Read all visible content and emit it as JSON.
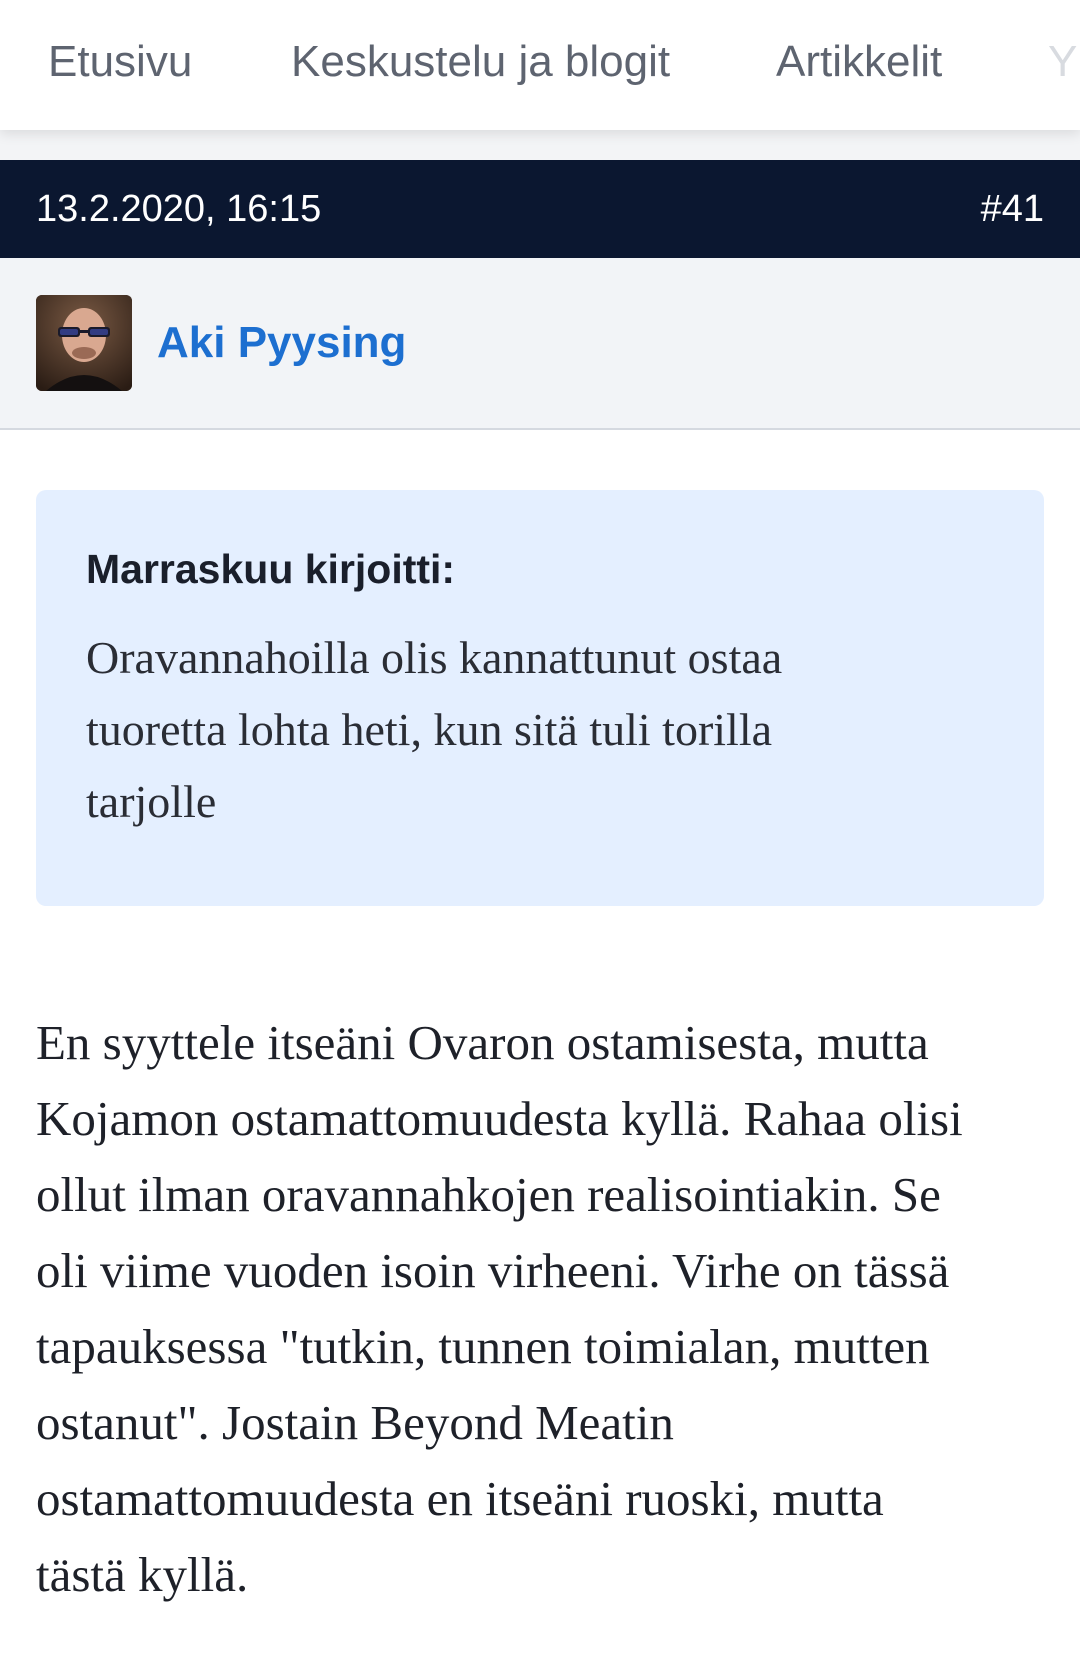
{
  "nav": {
    "tabs": [
      {
        "label": "Etusivu"
      },
      {
        "label": "Keskustelu ja blogit"
      },
      {
        "label": "Artikkelit"
      },
      {
        "label": "Y"
      }
    ]
  },
  "post": {
    "date": "13.2.2020, 16:15",
    "number": "#41",
    "author": "Aki Pyysing",
    "quote": {
      "author": "Marraskuu kirjoitti:",
      "lines": [
        "Oravannahoilla olis kannattunut ostaa",
        "tuoretta lohta heti, kun sitä tuli torilla",
        "tarjolle"
      ]
    },
    "body_lines": [
      "En syyttele itseäni Ovaron ostamisesta, mutta",
      "Kojamon ostamattomuudesta kyllä. Rahaa olisi",
      "ollut ilman oravannahkojen realisointiakin. Se",
      "oli viime vuoden isoin virheeni. Virhe on tässä",
      "tapauksessa \"tutkin, tunnen toimialan, mutten",
      "ostanut\". Jostain Beyond Meatin",
      "ostamattomuudesta en itseäni ruoski, mutta",
      "tästä kyllä."
    ]
  },
  "colors": {
    "header_bg": "#0b1730",
    "author_link": "#1d6fd0",
    "quote_bg": "#e4efff",
    "nav_text": "#5e6470"
  },
  "icons": {
    "avatar": "user-avatar-photo"
  }
}
